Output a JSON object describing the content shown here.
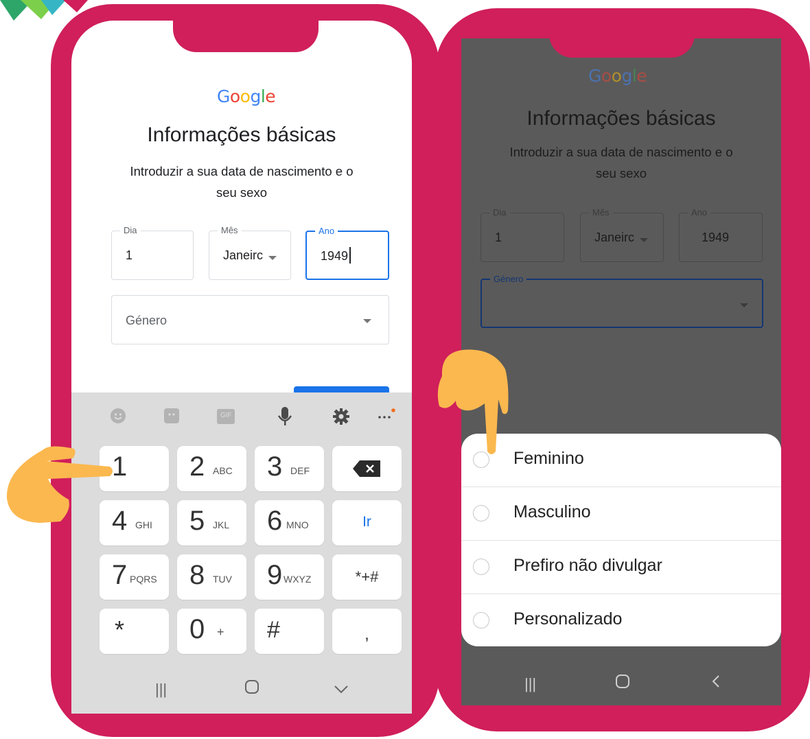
{
  "colors": {
    "phone_frame": "#d01f5b",
    "google_blue": "#4285F4",
    "google_red": "#EA4335",
    "google_yellow": "#FBBC05",
    "google_green": "#34A853",
    "focus_blue": "#1a73e8",
    "pointer_hand": "#fbb84f"
  },
  "left": {
    "logo": [
      "G",
      "o",
      "o",
      "g",
      "l",
      "e"
    ],
    "title": "Informações básicas",
    "subtitle_line1": "Introduzir a sua data de nascimento e o",
    "subtitle_line2": "seu sexo",
    "day": {
      "label": "Dia",
      "value": "1"
    },
    "month": {
      "label": "Mês",
      "value": "Janeirc"
    },
    "year": {
      "label": "Ano",
      "value": "1949"
    },
    "gender": {
      "placeholder": "Género"
    },
    "keyboard": {
      "toolbar": [
        "emoji-icon",
        "sticker-icon",
        "gif-icon",
        "microphone-icon",
        "gear-icon",
        "more-icon"
      ],
      "gif_label": "GIF",
      "keys": [
        {
          "main": "1",
          "sub": ""
        },
        {
          "main": "2",
          "sub": "ABC"
        },
        {
          "main": "3",
          "sub": "DEF"
        },
        {
          "main": "",
          "sub": ""
        },
        {
          "main": "4",
          "sub": "GHI"
        },
        {
          "main": "5",
          "sub": "JKL"
        },
        {
          "main": "6",
          "sub": "MNO"
        },
        {
          "main": "Ir",
          "sub": ""
        },
        {
          "main": "7",
          "sub": "PQRS"
        },
        {
          "main": "8",
          "sub": "TUV"
        },
        {
          "main": "9",
          "sub": "WXYZ"
        },
        {
          "main": "*+#",
          "sub": ""
        },
        {
          "main": "*",
          "sub": ""
        },
        {
          "main": "0",
          "sub": "+"
        },
        {
          "main": "#",
          "sub": ""
        },
        {
          "main": ",",
          "sub": ""
        }
      ],
      "nav": [
        "|||",
        "○",
        "∨"
      ]
    }
  },
  "right": {
    "logo": [
      "G",
      "o",
      "o",
      "g",
      "l",
      "e"
    ],
    "title": "Informações básicas",
    "subtitle_line1": "Introduzir a sua data de nascimento e o",
    "subtitle_line2": "seu sexo",
    "day": {
      "label": "Dia",
      "value": "1"
    },
    "month": {
      "label": "Mês",
      "value": "Janeirc"
    },
    "year": {
      "label": "Ano",
      "value": "1949"
    },
    "gender": {
      "label": "Género"
    },
    "options": [
      "Feminino",
      "Masculino",
      "Prefiro não divulgar",
      "Personalizado"
    ],
    "nav": [
      "|||",
      "○",
      "<"
    ]
  }
}
